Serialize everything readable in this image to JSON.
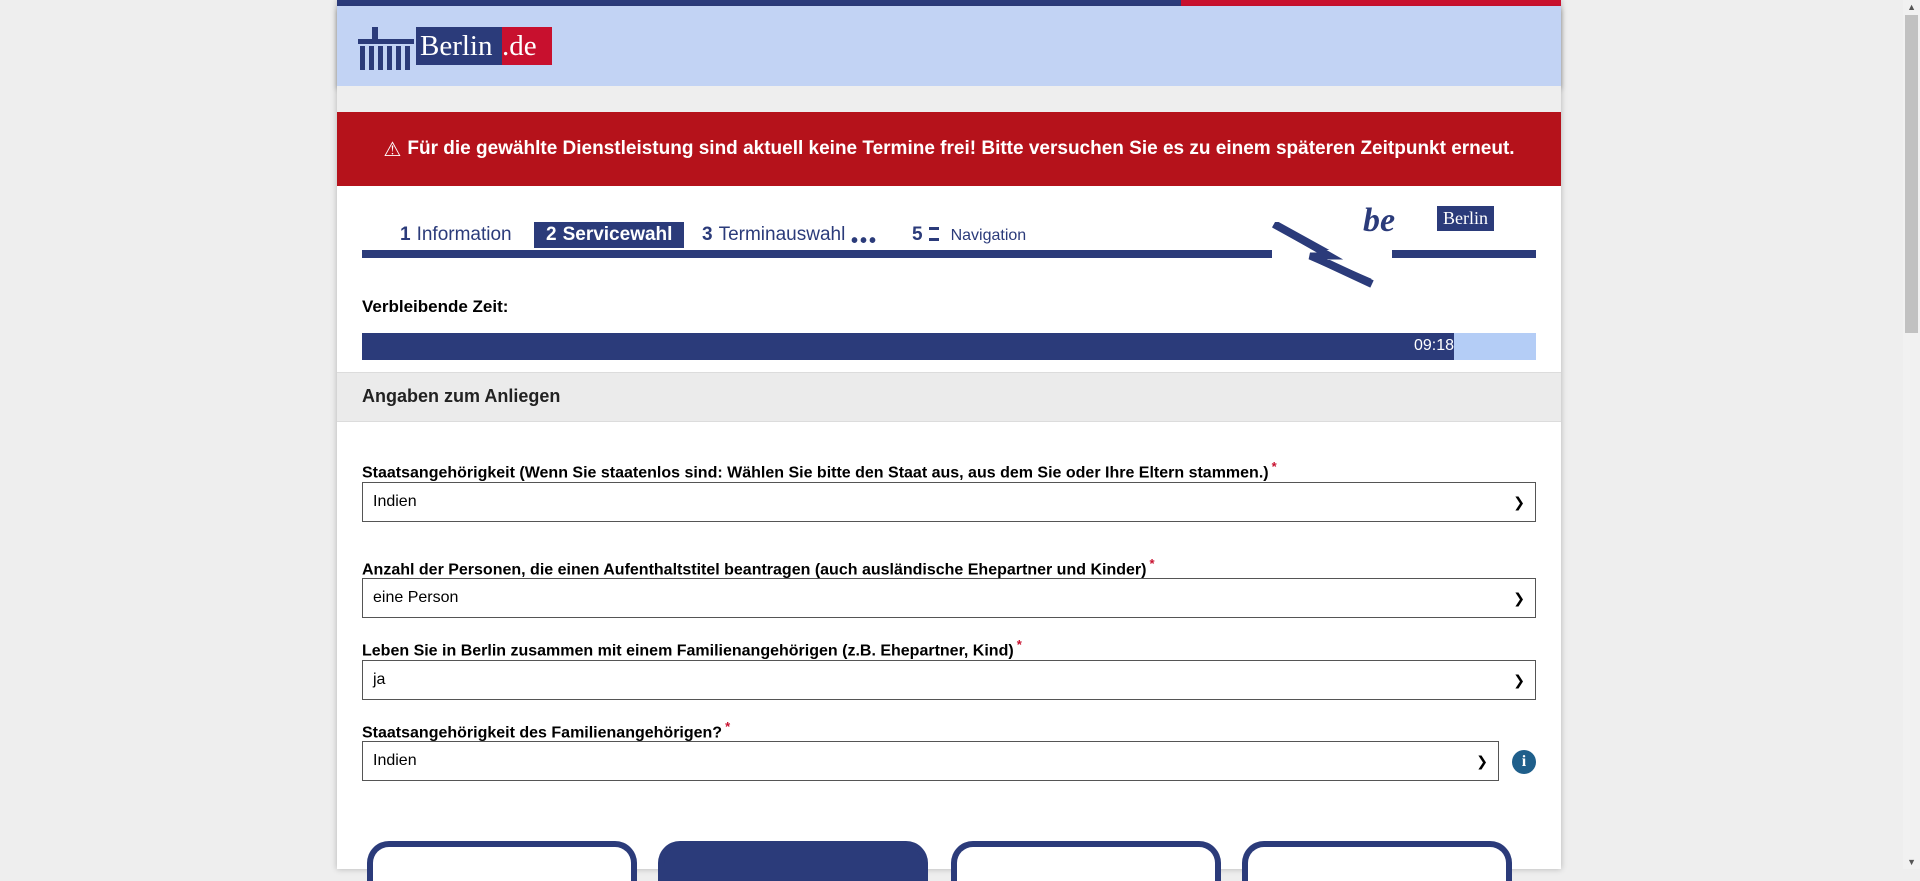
{
  "header": {
    "logo_berlin": "Berlin",
    "logo_de": ".de"
  },
  "alert": {
    "icon": "warning-icon",
    "text": "Für die gewählte Dienstleistung sind aktuell keine Termine frei! Bitte versuchen Sie es zu einem späteren Zeitpunkt erneut."
  },
  "steps": [
    {
      "num": "1",
      "label": "Information"
    },
    {
      "num": "2",
      "label": "Servicewahl"
    },
    {
      "num": "3",
      "label": "Terminauswahl"
    },
    {
      "num": "5",
      "label": "Navigation"
    }
  ],
  "steps_active": 1,
  "be_logo": {
    "be": "be",
    "berlin": "Berlin"
  },
  "timer": {
    "label": "Verbleibende Zeit:",
    "value": "09:18",
    "progress_fraction": 0.93
  },
  "section": {
    "title": "Angaben zum Anliegen"
  },
  "fields": [
    {
      "label": "Staatsangehörigkeit (Wenn Sie staatenlos sind: Wählen Sie bitte den Staat aus, aus dem Sie oder Ihre Eltern stammen.)",
      "value": "Indien"
    },
    {
      "label": "Anzahl der Personen, die einen Aufenthaltstitel beantragen (auch ausländische Ehepartner und Kinder)",
      "value": "eine Person"
    },
    {
      "label": "Leben Sie in Berlin zusammen mit einem Familienangehörigen (z.B. Ehepartner, Kind)",
      "value": "ja"
    },
    {
      "label": "Staatsangehörigkeit des Familienangehörigen?",
      "value": "Indien"
    }
  ],
  "required_marker": "*",
  "colors": {
    "brand_blue": "#2b3b7a",
    "brand_red": "#c8102e",
    "alert_red": "#b5121b",
    "header_bg": "#c2d3f4"
  }
}
